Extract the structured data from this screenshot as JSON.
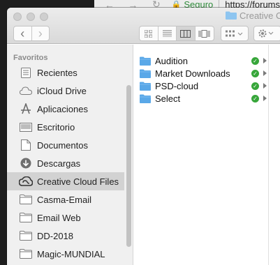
{
  "browser": {
    "back_glyph": "←",
    "forward_glyph": "→",
    "reload_glyph": "↻",
    "secure_label": "Seguro",
    "url_text": "https://forums"
  },
  "window": {
    "title": "Creative C"
  },
  "toolbar": {
    "back_glyph": "‹",
    "forward_glyph": "›",
    "view_modes": [
      "icon-view-icon",
      "list-view-icon",
      "column-view-icon",
      "coverflow-view-icon"
    ],
    "active_view": "column"
  },
  "sidebar": {
    "heading": "Favoritos",
    "items": [
      {
        "label": "Recientes",
        "icon": "recents-icon"
      },
      {
        "label": "iCloud Drive",
        "icon": "cloud-icon"
      },
      {
        "label": "Aplicaciones",
        "icon": "applications-icon"
      },
      {
        "label": "Escritorio",
        "icon": "desktop-icon"
      },
      {
        "label": "Documentos",
        "icon": "documents-icon"
      },
      {
        "label": "Descargas",
        "icon": "downloads-icon"
      },
      {
        "label": "Creative Cloud Files",
        "icon": "creative-cloud-icon"
      },
      {
        "label": "Casma-Email",
        "icon": "folder-icon"
      },
      {
        "label": "Email Web",
        "icon": "folder-icon"
      },
      {
        "label": "DD-2018",
        "icon": "folder-icon"
      },
      {
        "label": "Magic-MUNDIAL",
        "icon": "folder-icon"
      }
    ],
    "selected_index": 6
  },
  "files": [
    {
      "name": "Audition"
    },
    {
      "name": "Market Downloads"
    },
    {
      "name": "PSD-cloud"
    },
    {
      "name": "Select"
    }
  ],
  "colors": {
    "folder_blue": "#5aa8e8",
    "sync_green": "#37a63a",
    "secure_green": "#2e8b3a"
  }
}
